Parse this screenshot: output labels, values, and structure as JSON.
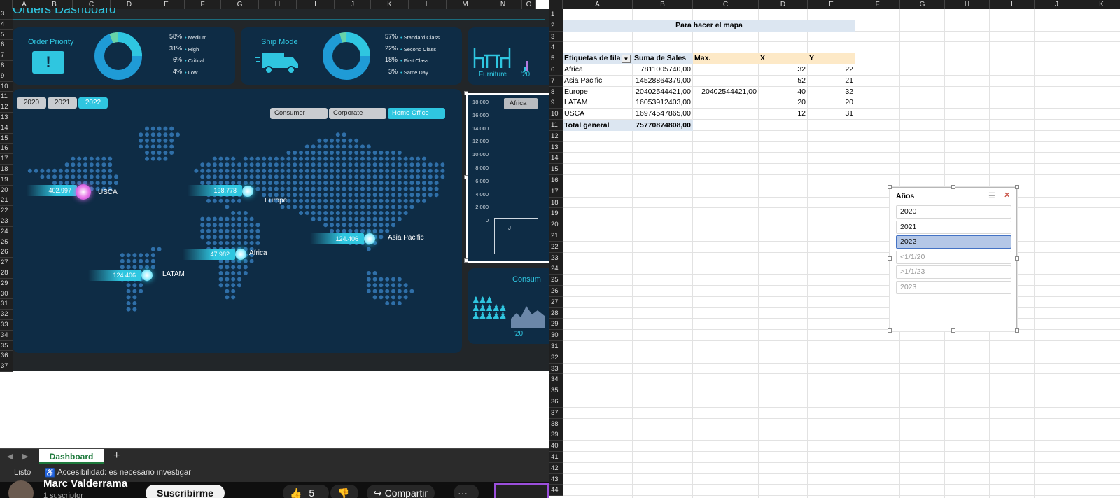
{
  "left_sheet": {
    "columns": [
      "A",
      "B",
      "C",
      "D",
      "E",
      "F",
      "G",
      "H",
      "I",
      "J",
      "K",
      "L",
      "M",
      "N",
      "O"
    ],
    "rows": [
      "3",
      "4",
      "5",
      "6",
      "7",
      "8",
      "9",
      "10",
      "11",
      "12",
      "13",
      "14",
      "15",
      "16",
      "17",
      "18",
      "19",
      "20",
      "21",
      "22",
      "23",
      "24",
      "25",
      "26",
      "27",
      "28",
      "29",
      "30",
      "31",
      "32",
      "33",
      "34",
      "35",
      "36",
      "37"
    ]
  },
  "dashboard": {
    "title": "Orders Dashboard",
    "order_priority": {
      "title": "Order Priority",
      "icon": "alert-icon",
      "items": [
        {
          "pct": "58%",
          "label": "Medium"
        },
        {
          "pct": "31%",
          "label": "High"
        },
        {
          "pct": "6%",
          "label": "Critical"
        },
        {
          "pct": "4%",
          "label": "Low"
        }
      ]
    },
    "ship_mode": {
      "title": "Ship Mode",
      "icon": "truck-icon",
      "items": [
        {
          "pct": "57%",
          "label": "Standard Class"
        },
        {
          "pct": "22%",
          "label": "Second Class"
        },
        {
          "pct": "18%",
          "label": "First Class"
        },
        {
          "pct": "3%",
          "label": "Same Day"
        }
      ]
    },
    "category": {
      "label": "Furniture",
      "year": "'20",
      "icon": "furniture-icon"
    },
    "years": [
      "2020",
      "2021",
      "2022"
    ],
    "selected_year": "2022",
    "segments": [
      "Consumer",
      "Corporate",
      "Home Office"
    ],
    "selected_segment": "Home Office",
    "regions": [
      {
        "name": "USCA",
        "value": "402.997"
      },
      {
        "name": "Europe",
        "value": "198.778"
      },
      {
        "name": "Asia Pacific",
        "value": "124.406"
      },
      {
        "name": "Africa",
        "value": "47.982"
      },
      {
        "name": "LATAM",
        "value": "124.406"
      }
    ],
    "mini_chart": {
      "filter": "Africa",
      "yticks": [
        "18.000",
        "16.000",
        "14.000",
        "12.000",
        "10.000",
        "8.000",
        "6.000",
        "4.000",
        "2.000",
        "0"
      ],
      "x_label": "J"
    },
    "consumer_card": {
      "label": "Consum",
      "year": "'20",
      "icon": "people-icon"
    }
  },
  "tabs": {
    "sheet": "Dashboard",
    "add": "+"
  },
  "status": {
    "ready": "Listo",
    "accessibility": "Accesibilidad: es necesario investigar"
  },
  "youtube": {
    "channel": "Marc Valderrama",
    "subs": "1 suscriptor",
    "subscribe": "Suscribirme",
    "likes": "5",
    "share": "Compartir",
    "more": "···"
  },
  "right_sheet": {
    "columns": [
      "A",
      "B",
      "C",
      "D",
      "E",
      "F",
      "G",
      "H",
      "I",
      "J",
      "K"
    ],
    "rows": [
      "1",
      "2",
      "3",
      "4",
      "5",
      "6",
      "7",
      "8",
      "9",
      "10",
      "11",
      "12",
      "13",
      "14",
      "15",
      "16",
      "17",
      "18",
      "19",
      "20",
      "21",
      "22",
      "23",
      "24",
      "25",
      "26",
      "27",
      "28",
      "29",
      "30",
      "31",
      "32",
      "33",
      "34",
      "35",
      "36",
      "37",
      "38",
      "39",
      "40",
      "41",
      "42",
      "43",
      "44"
    ],
    "title_cell": "Para hacer el mapa",
    "headers": [
      "Etiquetas de fila",
      "Suma de Sales",
      "Max.",
      "X",
      "Y"
    ],
    "table": [
      {
        "label": "Africa",
        "sales": "7811005740,00",
        "max": "",
        "x": "32",
        "y": "22"
      },
      {
        "label": "Asia Pacific",
        "sales": "14528864379,00",
        "max": "",
        "x": "52",
        "y": "21"
      },
      {
        "label": "Europe",
        "sales": "20402544421,00",
        "max": "20402544421,00",
        "x": "40",
        "y": "32"
      },
      {
        "label": "LATAM",
        "sales": "16053912403,00",
        "max": "",
        "x": "20",
        "y": "20"
      },
      {
        "label": "USCA",
        "sales": "16974547865,00",
        "max": "",
        "x": "12",
        "y": "31"
      }
    ],
    "total": {
      "label": "Total general",
      "sales": "75770874808,00"
    }
  },
  "slicer": {
    "title": "Años",
    "items": [
      "2020",
      "2021",
      "2022",
      "<1/1/20",
      ">1/1/23",
      "2023"
    ],
    "selected": "2022",
    "disabled": [
      "<1/1/20",
      ">1/1/23",
      "2023"
    ]
  },
  "colors": {
    "accent": "#2fc6e0",
    "panel": "#0e2c45",
    "map_dot": "#2f6fa8",
    "header_fill": "#fde9c7",
    "title_fill": "#dce6f1",
    "slicer_selected": "#b4c7e7"
  }
}
